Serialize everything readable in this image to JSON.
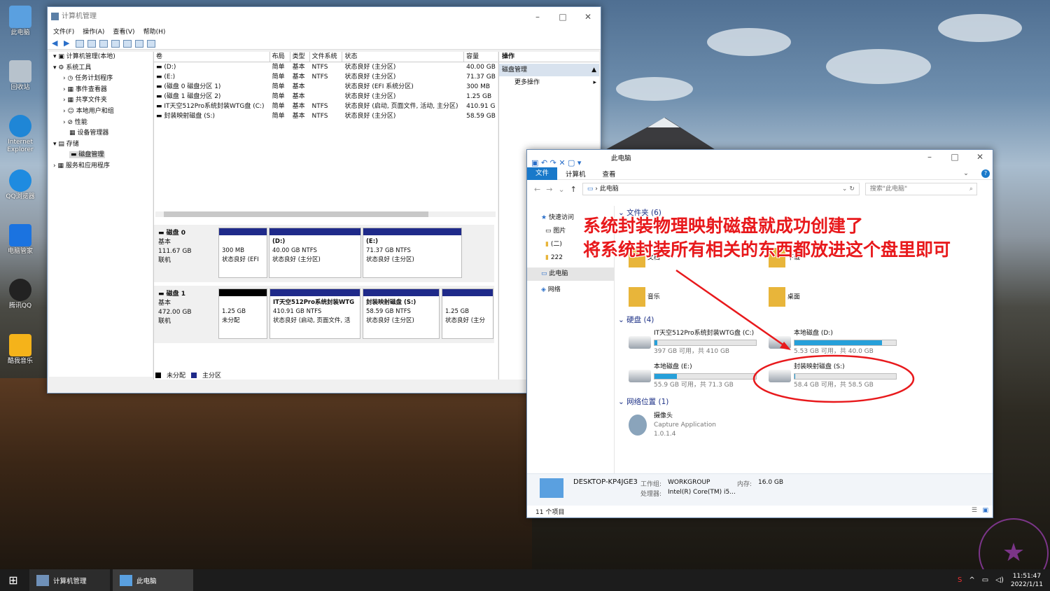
{
  "desktop_icons": [
    {
      "label": "此电脑",
      "icon": "computer-icon"
    },
    {
      "label": "回收站",
      "icon": "recycle-bin-icon"
    },
    {
      "label": "Internet Explorer",
      "icon": "ie-icon"
    },
    {
      "label": "QQ浏览器",
      "icon": "qq-browser-icon"
    },
    {
      "label": "电脑管家",
      "icon": "pc-manager-icon"
    },
    {
      "label": "腾讯QQ",
      "icon": "qq-icon"
    },
    {
      "label": "酷我音乐",
      "icon": "kuwo-music-icon"
    }
  ],
  "cm": {
    "title": "计算机管理",
    "menu": [
      "文件(F)",
      "操作(A)",
      "查看(V)",
      "帮助(H)"
    ],
    "tree": [
      "计算机管理(本地)",
      "系统工具",
      "任务计划程序",
      "事件查看器",
      "共享文件夹",
      "本地用户和组",
      "性能",
      "设备管理器",
      "存储",
      "磁盘管理",
      "服务和应用程序"
    ],
    "cols": [
      "卷",
      "布局",
      "类型",
      "文件系统",
      "状态",
      "容量"
    ],
    "volumes": [
      [
        "(D:)",
        "简单",
        "基本",
        "NTFS",
        "状态良好 (主分区)",
        "40.00 GB"
      ],
      [
        "(E:)",
        "简单",
        "基本",
        "NTFS",
        "状态良好 (主分区)",
        "71.37 GB"
      ],
      [
        "(磁盘 0 磁盘分区 1)",
        "简单",
        "基本",
        "",
        "状态良好 (EFI 系统分区)",
        "300 MB"
      ],
      [
        "(磁盘 1 磁盘分区 2)",
        "简单",
        "基本",
        "",
        "状态良好 (主分区)",
        "1.25 GB"
      ],
      [
        "IT天空512Pro系统封装WTG盘 (C:)",
        "简单",
        "基本",
        "NTFS",
        "状态良好 (启动, 页面文件, 活动, 主分区)",
        "410.91 G"
      ],
      [
        "封装映射磁盘 (S:)",
        "简单",
        "基本",
        "NTFS",
        "状态良好 (主分区)",
        "58.59 GB"
      ]
    ],
    "disk0": {
      "name": "磁盘 0",
      "type": "基本",
      "size": "111.67 GB",
      "status": "联机",
      "parts": [
        {
          "l1": "",
          "l2": "300 MB",
          "l3": "状态良好 (EFI"
        },
        {
          "l1": "(D:)",
          "l2": "40.00 GB NTFS",
          "l3": "状态良好 (主分区)"
        },
        {
          "l1": "(E:)",
          "l2": "71.37 GB NTFS",
          "l3": "状态良好 (主分区)"
        }
      ]
    },
    "disk1": {
      "name": "磁盘 1",
      "type": "基本",
      "size": "472.00 GB",
      "status": "联机",
      "parts": [
        {
          "l1": "",
          "l2": "1.25 GB",
          "l3": "未分配"
        },
        {
          "l1": "IT天空512Pro系统封装WTG",
          "l2": "410.91 GB NTFS",
          "l3": "状态良好 (启动, 页面文件, 活"
        },
        {
          "l1": "封装映射磁盘 (S:)",
          "l2": "58.59 GB NTFS",
          "l3": "状态良好 (主分区)"
        },
        {
          "l1": "",
          "l2": "1.25 GB",
          "l3": "状态良好 (主分"
        }
      ]
    },
    "legend": [
      "未分配",
      "主分区"
    ],
    "ops": {
      "header": "操作",
      "section": "磁盘管理",
      "more": "更多操作"
    }
  },
  "fe": {
    "title": "此电脑",
    "ribbon": [
      "文件",
      "计算机",
      "查看"
    ],
    "address": "此电脑",
    "search_placeholder": "搜索\"此电脑\"",
    "nav": [
      "快速访问",
      "图片",
      "(二)",
      "222",
      "此电脑",
      "网络"
    ],
    "folders_header": "文件夹 (6)",
    "folders": [
      "文档",
      "下载",
      "音乐",
      "桌面"
    ],
    "drives_header": "硬盘 (4)",
    "drives": [
      {
        "name": "IT天空512Pro系统封装WTG盘 (C:)",
        "free": "397 GB 可用，共 410 GB",
        "used": 0.03
      },
      {
        "name": "本地磁盘 (D:)",
        "free": "5.53 GB 可用，共 40.0 GB",
        "used": 0.86
      },
      {
        "name": "本地磁盘 (E:)",
        "free": "55.9 GB 可用，共 71.3 GB",
        "used": 0.22
      },
      {
        "name": "封装映射磁盘 (S:)",
        "free": "58.4 GB 可用，共 58.5 GB",
        "used": 0.01
      }
    ],
    "network_header": "网络位置 (1)",
    "network": {
      "name": "摄像头",
      "sub1": "Capture Application",
      "sub2": "1.0.1.4"
    },
    "details": {
      "pc": "DESKTOP-KP4JGE3",
      "wg_label": "工作组:",
      "wg": "WORKGROUP",
      "mem_label": "内存:",
      "mem": "16.0 GB",
      "cpu_label": "处理器:",
      "cpu": "Intel(R) Core(TM) i5..."
    },
    "status": "11 个项目"
  },
  "annotation": {
    "line1": "系统封装物理映射磁盘就成功创建了",
    "line2": "将系统封装所有相关的东西都放进这个盘里即可",
    "color": "#e8191c"
  },
  "taskbar": {
    "apps": [
      "计算机管理",
      "此电脑"
    ],
    "time": "11:51:47",
    "date": "2022/1/11"
  }
}
